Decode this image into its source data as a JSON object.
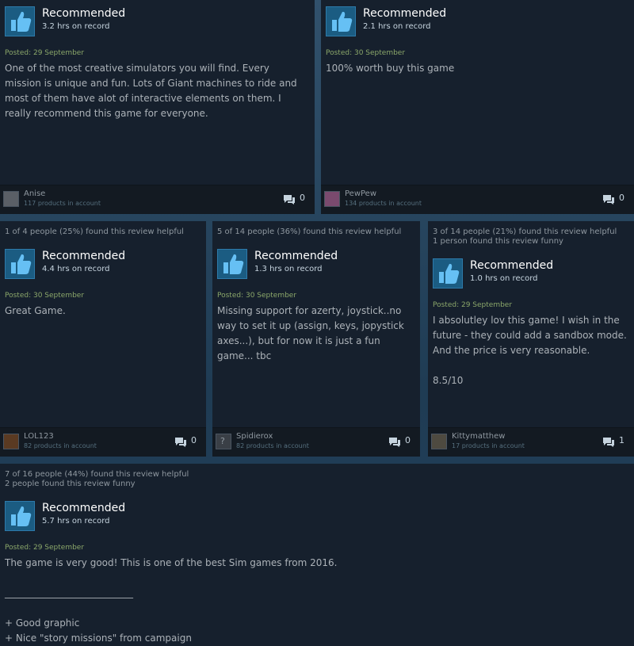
{
  "reviews": [
    {
      "helpful": "",
      "funny": "",
      "recommendation": "Recommended",
      "hours": "3.2 hrs on record",
      "posted": "Posted: 29 September",
      "paragraphs": [
        "One of the most creative simulators you will find. Every mission is unique and fun. Lots of Giant machines to ride and most of them have alot of interactive elements on them. I really recommend this game for everyone."
      ],
      "username": "Anise",
      "products": "117 products in account",
      "comments": "0",
      "avatar_color": "#5a5f66"
    },
    {
      "helpful": "",
      "funny": "",
      "recommendation": "Recommended",
      "hours": "2.1 hrs on record",
      "posted": "Posted: 30 September",
      "paragraphs": [
        "100% worth buy this game"
      ],
      "username": "PewPew",
      "products": "134 products in account",
      "comments": "0",
      "avatar_color": "#7a4a6e"
    },
    {
      "helpful": "1 of 4 people (25%) found this review helpful",
      "funny": "",
      "recommendation": "Recommended",
      "hours": "4.4 hrs on record",
      "posted": "Posted: 30 September",
      "paragraphs": [
        "Great Game."
      ],
      "username": "LOL123",
      "products": "82 products in account",
      "comments": "0",
      "avatar_color": "#5a3a22"
    },
    {
      "helpful": "5 of 14 people (36%) found this review helpful",
      "funny": "",
      "recommendation": "Recommended",
      "hours": "1.3 hrs on record",
      "posted": "Posted: 30 September",
      "paragraphs": [
        "Missing support for azerty, joystick..no way to set it up (assign, keys, jopystick axes...), but for now it is just a fun game... tbc"
      ],
      "username": "Spidierox",
      "products": "82 products in account",
      "comments": "0",
      "avatar_color": "#3a3f46",
      "avatar_text": "?"
    },
    {
      "helpful": "3 of 14 people (21%) found this review helpful",
      "funny": "1 person found this review funny",
      "recommendation": "Recommended",
      "hours": "1.0 hrs on record",
      "posted": "Posted: 29 September",
      "paragraphs": [
        "I absolutley lov this game! I wish in the future - they could add a sandbox mode. And the price is very reasonable.",
        "8.5/10"
      ],
      "username": "Kittymatthew",
      "products": "17 products in account",
      "comments": "1",
      "avatar_color": "#4e4a40"
    },
    {
      "helpful": "7 of 16 people (44%) found this review helpful",
      "funny": "2 people found this review funny",
      "recommendation": "Recommended",
      "hours": "5.7 hrs on record",
      "posted": "Posted: 29 September",
      "paragraphs": [
        "The game is very good! This is one of the best Sim games from 2016.",
        "___________________________",
        "+ Good graphic",
        "+ Nice \"story missions\" from campaign"
      ],
      "username": "",
      "products": "",
      "comments": "",
      "avatar_color": "#3a3f46"
    }
  ],
  "colors": {
    "accent": "#1b5c82",
    "posted": "#8ba76a"
  },
  "icons": {
    "vote": "thumbs-up-icon",
    "comment": "comment-icon"
  }
}
